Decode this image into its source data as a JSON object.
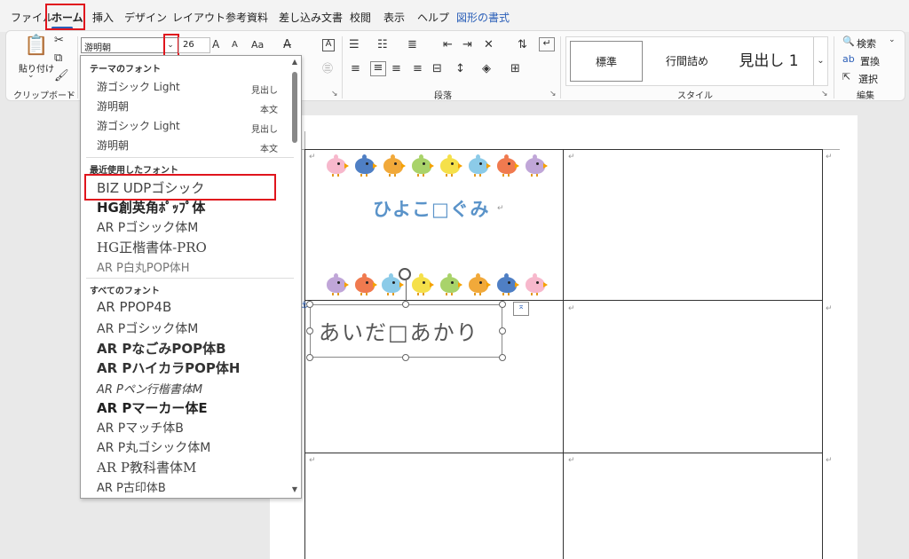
{
  "tabs": [
    "ファイル",
    "ホーム",
    "挿入",
    "デザイン",
    "レイアウト",
    "参考資料",
    "差し込み文書",
    "校閲",
    "表示",
    "ヘルプ",
    "図形の書式"
  ],
  "ribbon": {
    "clipboard": {
      "paste_label": "貼り付け",
      "group_label": "クリップボード"
    },
    "font": {
      "current_font": "游明朝",
      "current_size": "26",
      "grow": "A",
      "shrink": "A",
      "case": "Aa"
    },
    "paragraph": {
      "group_label": "段落"
    },
    "styles": {
      "group_label": "スタイル",
      "items": [
        "標準",
        "行間詰め",
        "見出し 1"
      ]
    },
    "editing": {
      "group_label": "編集",
      "find": "検索",
      "replace": "置換",
      "select": "選択"
    }
  },
  "font_dropdown": {
    "theme_header": "テーマのフォント",
    "theme_fonts": [
      {
        "name": "游ゴシック Light",
        "tag": "見出し"
      },
      {
        "name": "游明朝",
        "tag": "本文"
      },
      {
        "name": "游ゴシック Light",
        "tag": "見出し"
      },
      {
        "name": "游明朝",
        "tag": "本文"
      }
    ],
    "recent_header": "最近使用したフォント",
    "recent_fonts": [
      "BIZ UDPゴシック",
      "HG創英角ﾎﾟｯﾌﾟ体",
      "AR Pゴシック体M",
      "HG正楷書体-PRO",
      "AR P白丸POP体H"
    ],
    "all_header": "すべてのフォント",
    "all_fonts": [
      "AR PPOP4B",
      "AR Pゴシック体M",
      "AR PなごみPOP体B",
      "AR PハイカラPOP体H",
      "AR Pペン行楷書体M",
      "AR Pマーカー体E",
      "AR Pマッチ体B",
      "AR P丸ゴシック体M",
      "AR P教科書体M",
      "AR P古印体B"
    ]
  },
  "document": {
    "class_title": "ひよこ□ぐみ",
    "name_text": "あいだ□あかり"
  }
}
